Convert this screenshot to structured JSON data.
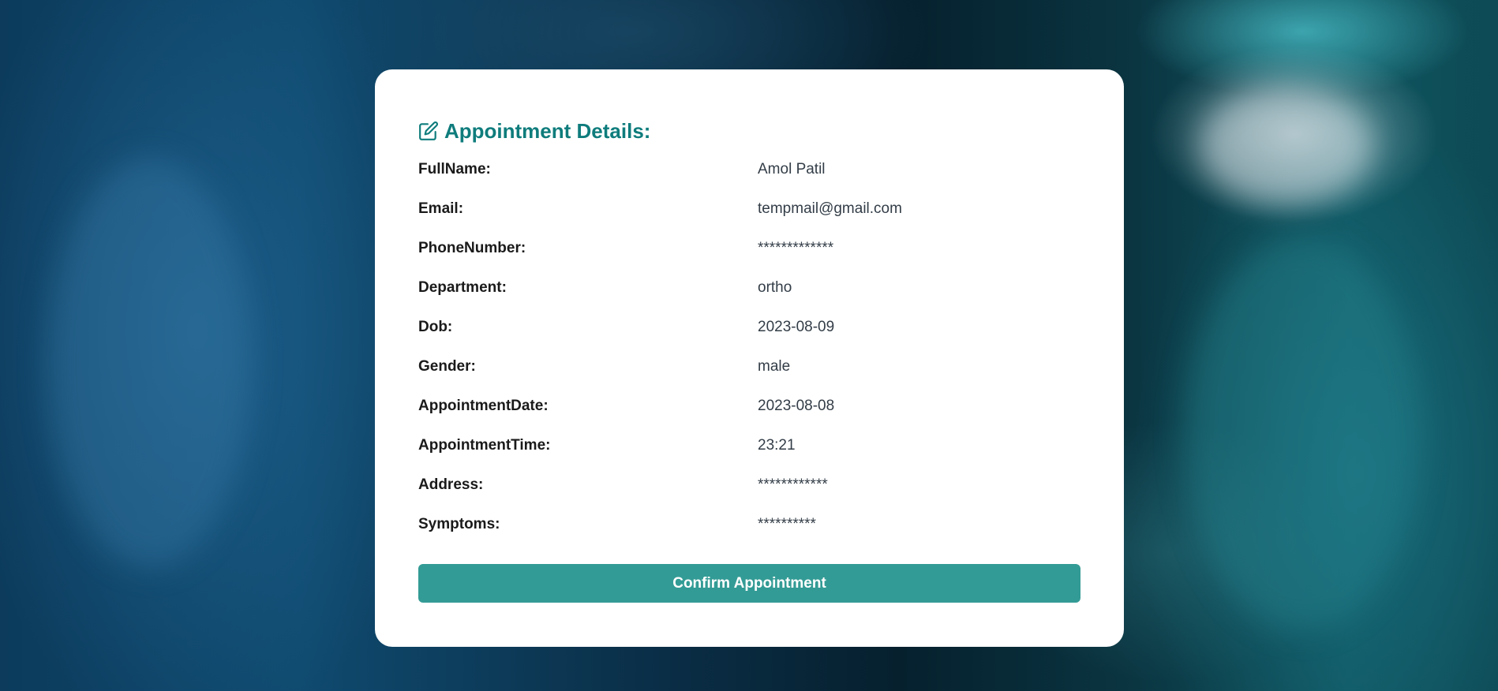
{
  "card": {
    "title": "Appointment Details:",
    "title_icon": "edit-icon",
    "accent_color": "#0f7c7c",
    "fields": [
      {
        "label": "FullName:",
        "value": "Amol Patil"
      },
      {
        "label": "Email:",
        "value": "tempmail@gmail.com"
      },
      {
        "label": "PhoneNumber:",
        "value": "*************"
      },
      {
        "label": "Department:",
        "value": "ortho"
      },
      {
        "label": "Dob:",
        "value": "2023-08-09"
      },
      {
        "label": "Gender:",
        "value": "male"
      },
      {
        "label": "AppointmentDate:",
        "value": "2023-08-08"
      },
      {
        "label": "AppointmentTime:",
        "value": "23:21"
      },
      {
        "label": "Address:",
        "value": "************"
      },
      {
        "label": "Symptoms:",
        "value": "**********"
      }
    ],
    "confirm_button": {
      "label": "Confirm Appointment",
      "color": "#339b95"
    }
  }
}
